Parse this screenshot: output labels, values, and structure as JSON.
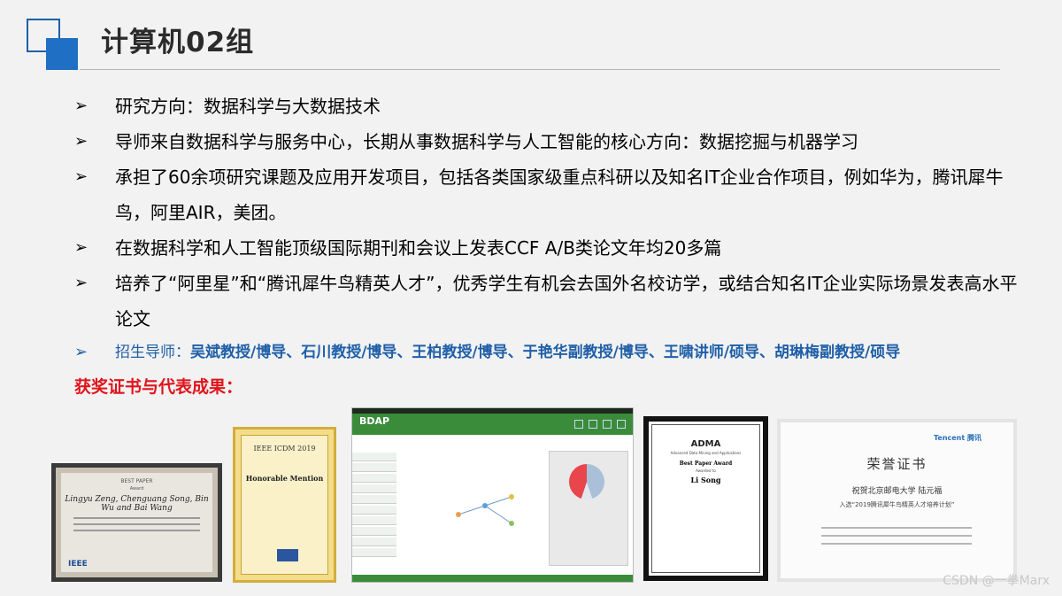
{
  "header": {
    "title": "计算机02组"
  },
  "bullets": [
    {
      "arrow": "➢",
      "text": "研究方向：数据科学与大数据技术"
    },
    {
      "arrow": "➢",
      "text": "导师来自数据科学与服务中心，长期从事数据科学与人工智能的核心方向：数据挖掘与机器学习"
    },
    {
      "arrow": "➢",
      "text": "承担了60余项研究课题及应用开发项目，包括各类国家级重点科研以及知名IT企业合作项目，例如华为，腾讯犀牛鸟，阿里AIR，美团。"
    },
    {
      "arrow": "➢",
      "text": "在数据科学和人工智能顶级国际期刊和会议上发表CCF A/B类论文年均20多篇"
    },
    {
      "arrow": "➢",
      "text": "培养了“阿里星”和“腾讯犀牛鸟精英人才”，优秀学生有机会去国外名校访学，或结合知名IT企业实际场景发表高水平论文"
    }
  ],
  "advisors": {
    "arrow": "➢",
    "label": "招生导师：",
    "names": "吴斌教授/博导、石川教授/博导、王柏教授/博导、于艳华副教授/博导、王啸讲师/硕导、胡琳梅副教授/硕导"
  },
  "awards_heading": "获奖证书与代表成果：",
  "images": {
    "cert1": {
      "title": "BEST PAPER",
      "sub": "Award",
      "authors": "Lingyu Zeng, Chenguang Song, Bin Wu and Bai Wang",
      "logo": "IEEE"
    },
    "cert2": {
      "title": "IEEE ICDM 2019",
      "award": "Honorable Mention"
    },
    "screen": {
      "brand": "BDAP"
    },
    "cert4": {
      "logo": "ADMA",
      "award": "Best Paper Award",
      "awarded": "Awarded to",
      "name": "Li Song"
    },
    "cert5": {
      "brand": "Tencent 腾讯",
      "title": "荣誉证书",
      "line1": "祝贺北京邮电大学 陆元福",
      "line2": "入选“2019腾讯犀牛鸟精英人才培养计划”"
    }
  },
  "watermark": "CSDN @一拳Marx"
}
